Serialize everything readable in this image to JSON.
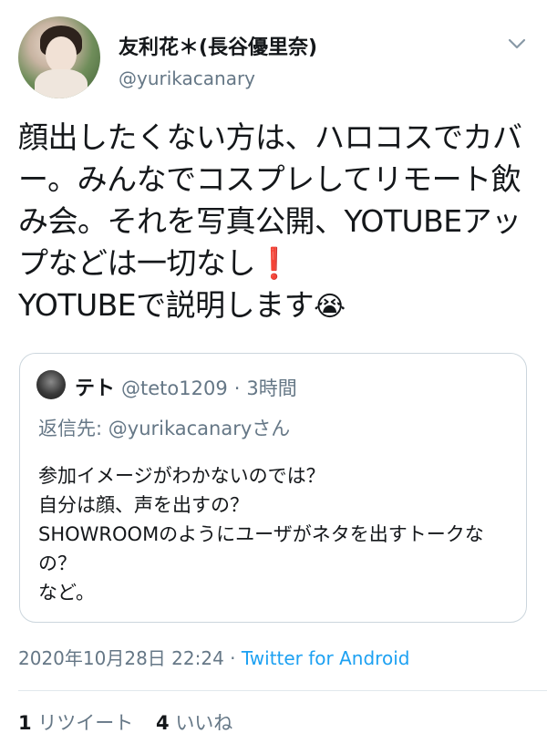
{
  "author": {
    "display_name": "友利花＊(長谷優里奈)",
    "handle": "@yurikacanary"
  },
  "tweet": {
    "text": "顔出したくない方は、ハロコスでカバー。みんなでコスプレしてリモート飲み会。それを写真公開、YOTUBEアップなどは一切なし",
    "text_line2": "YOTUBEで説明します",
    "exclamation_glyph": "❗",
    "crying_glyph": "😭"
  },
  "quoted_tweet": {
    "display_name": "テト",
    "handle": "@teto1209",
    "separator": "·",
    "time": "3時間",
    "reply_label": "返信先:",
    "reply_to": "@yurikacanaryさん",
    "text": "参加イメージがわかないのでは？\n自分は顔、声を出すの？\nSHOWROOMのようにユーザがネタを出すトークなの？\nなど。"
  },
  "meta": {
    "datetime": "2020年10月28日 22:24",
    "separator": "·",
    "source": "Twitter for Android"
  },
  "stats": {
    "retweet_count": "1",
    "retweet_label": "リツイート",
    "like_count": "4",
    "like_label": "いいね"
  },
  "icons": {
    "menu": "chevron-down-icon"
  },
  "colors": {
    "link": "#1da1f2",
    "muted": "#657786",
    "border": "#ccd6dd"
  }
}
